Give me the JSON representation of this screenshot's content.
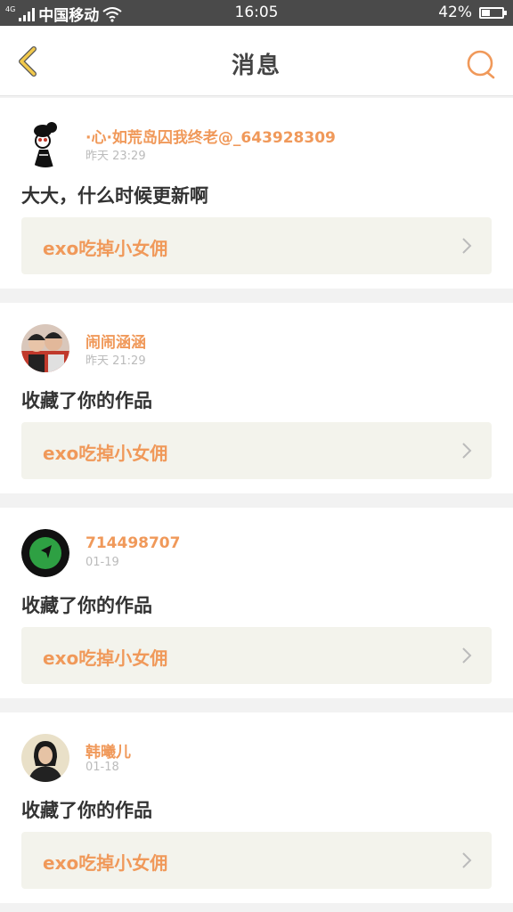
{
  "status": {
    "network": "4G",
    "carrier": "中国移动",
    "time": "16:05",
    "battery": "42%",
    "battery_level": 0.42
  },
  "nav": {
    "title": "消息",
    "back_icon": "chevron-left-icon",
    "search_icon": "search-icon"
  },
  "colors": {
    "accent": "#f0995a",
    "back_icon": "#f2c94c",
    "card_bg": "#f3f3ec"
  },
  "messages": [
    {
      "name": "·心·如荒岛囚我终老@_643928309",
      "time": "昨天  23:29",
      "text": "大大，什么时候更新啊",
      "work": "exo吃掉小女佣"
    },
    {
      "name": "闹闹涵涵",
      "time": "昨天  21:29",
      "text": "收藏了你的作品",
      "work": "exo吃掉小女佣"
    },
    {
      "name": "714498707",
      "time": "01-19",
      "text": "收藏了你的作品",
      "work": "exo吃掉小女佣"
    },
    {
      "name": "韩曦儿",
      "time": "01-18",
      "text": "收藏了你的作品",
      "work": "exo吃掉小女佣"
    }
  ]
}
